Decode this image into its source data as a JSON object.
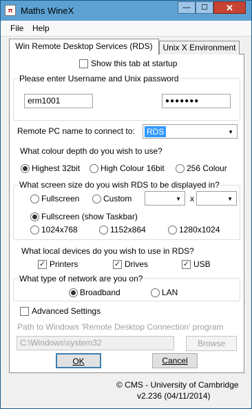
{
  "window": {
    "title": "Maths WineX",
    "icon": "app-icon",
    "close_glyph": "✕",
    "min_glyph": "—",
    "max_glyph": "☐"
  },
  "menu": {
    "file": "File",
    "help": "Help"
  },
  "tabs": {
    "active": "Win Remote Desktop Services (RDS)",
    "inactive": "Unix X Environment"
  },
  "startup": {
    "label": "Show this tab at startup",
    "checked": false
  },
  "credentials": {
    "legend": "Please enter Username and Unix password",
    "username": "erm1001",
    "password": "●●●●●●●"
  },
  "remote_pc": {
    "label": "Remote PC name to connect to:",
    "value": "RDS"
  },
  "colour_depth": {
    "question": "What colour depth do you wish to use?",
    "options": [
      "Highest 32bit",
      "High Colour 16bit",
      "256 Colour"
    ],
    "selected": "Highest 32bit"
  },
  "screen_size": {
    "legend": "What screen size do you wish RDS to be displayed in?",
    "fullscreen": "Fullscreen",
    "custom": "Custom",
    "x_sep": "x",
    "fullscreen_taskbar": "Fullscreen (show Taskbar)",
    "res1": "1024x768",
    "res2": "1152x864",
    "res3": "1280x1024",
    "selected": "Fullscreen (show Taskbar)"
  },
  "devices": {
    "question": "What local devices do you wish to use in RDS?",
    "printers": "Printers",
    "drives": "Drives",
    "usb": "USB",
    "check_glyph": "✓"
  },
  "network": {
    "legend": "What type of network are you on?",
    "broadband": "Broadband",
    "lan": "LAN",
    "selected": "Broadband"
  },
  "advanced": {
    "label": "Advanced Settings",
    "checked": false
  },
  "rdc_path": {
    "label": "Path to Windows 'Remote Desktop Connection' program",
    "value": "C:\\Windows\\system32",
    "browse": "Browse"
  },
  "buttons": {
    "ok": "OK",
    "cancel": "Cancel"
  },
  "footer": {
    "copyright": "© CMS - University of Cambridge",
    "version": "v2.236 (04/11/2014)"
  }
}
